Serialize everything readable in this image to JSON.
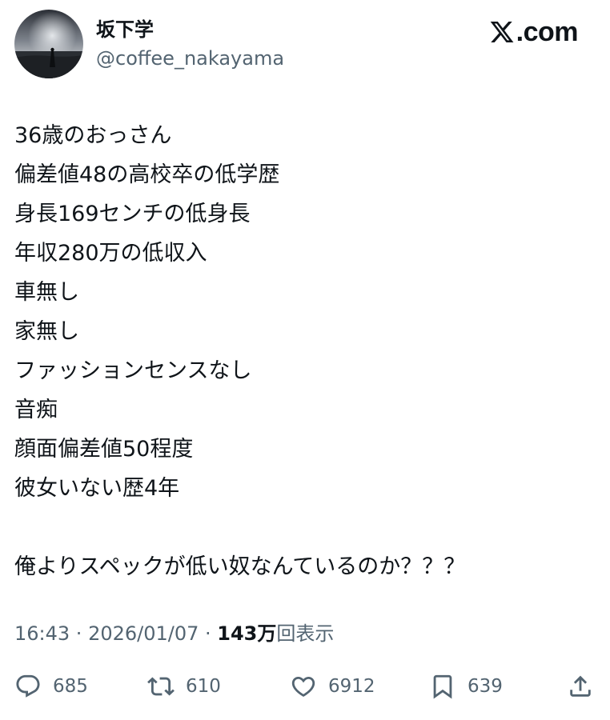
{
  "author": {
    "display_name": "坂下学",
    "handle": "@coffee_nakayama"
  },
  "brand": {
    "text": ".com",
    "icon": "x-logo-icon"
  },
  "tweet": {
    "lines": [
      "36歳のおっさん",
      "偏差値48の高校卒の低学歴",
      "身長169センチの低身長",
      "年収280万の低収入",
      "車無し",
      "家無し",
      "ファッションセンスなし",
      "音痴",
      "顔面偏差値50程度",
      "彼女いない歴4年",
      "",
      "俺よりスペックが低い奴なんているのか？？？"
    ]
  },
  "meta": {
    "time": "16:43",
    "separator": " · ",
    "date": "2026/01/07",
    "views_count": "143万",
    "views_label": "回表示"
  },
  "actions": {
    "reply": {
      "icon": "reply-icon",
      "count": "685"
    },
    "repost": {
      "icon": "repost-icon",
      "count": "610"
    },
    "like": {
      "icon": "heart-icon",
      "count": "6912"
    },
    "bookmark": {
      "icon": "bookmark-icon",
      "count": "639"
    },
    "share": {
      "icon": "share-icon"
    }
  },
  "colors": {
    "text": "#0f1419",
    "secondary": "#536471",
    "background": "#ffffff"
  }
}
